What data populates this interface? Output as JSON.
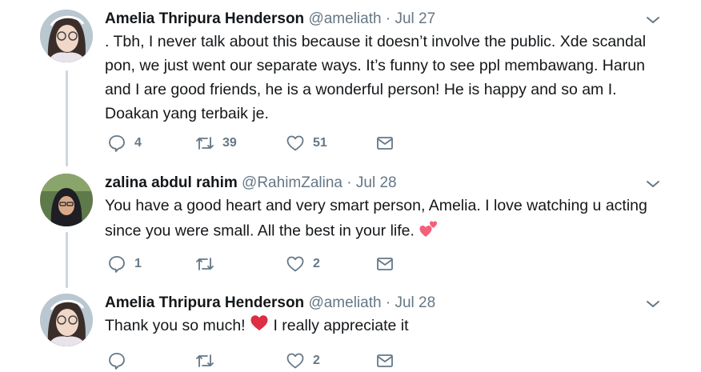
{
  "tweets": [
    {
      "name": "Amelia Thripura Henderson",
      "handle": "@ameliath",
      "separator": "·",
      "date": "Jul 27",
      "text": ". Tbh, I never talk about this because it doesn’t involve the public. Xde scandal pon, we just went our separate ways. It’s funny to see ppl membawang. Harun and I are good friends, he is a wonderful person! He is happy and so am I. Doakan yang terbaik je.",
      "replies": "4",
      "retweets": "39",
      "likes": "51"
    },
    {
      "name": "zalina abdul rahim",
      "handle": "@RahimZalina",
      "separator": "·",
      "date": "Jul 28",
      "text": "You have a good heart and very smart person, Amelia. I love watching u acting since you were small. All the best in your life.",
      "replies": "1",
      "retweets": "",
      "likes": "2"
    },
    {
      "name": "Amelia Thripura Henderson",
      "handle": "@ameliath",
      "separator": "·",
      "date": "Jul 28",
      "text_before": "Thank you so much!",
      "text_after": "I really appreciate it",
      "replies": "",
      "retweets": "",
      "likes": "2"
    }
  ],
  "icons": {
    "reply": "reply-icon",
    "retweet": "retweet-icon",
    "like": "heart-icon",
    "dm": "envelope-icon",
    "more": "chevron-down-icon",
    "emoji_two_hearts": "two-hearts-emoji",
    "emoji_heart": "red-heart-emoji"
  },
  "colors": {
    "name": "#14171a",
    "secondary": "#657786",
    "thread_line": "#ccd6dd",
    "heart_emoji": "#dd2e44",
    "pink_hearts": "#f4607a"
  }
}
